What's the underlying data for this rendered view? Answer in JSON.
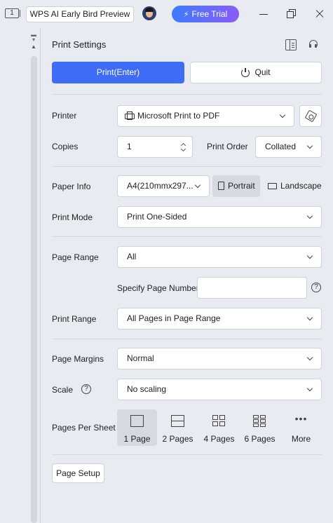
{
  "titlebar": {
    "page_count_badge": "1",
    "tab_title": "WPS AI Early Bird Preview",
    "free_trial_label": "Free Trial",
    "accent_gradient": [
      "#3d7bff",
      "#8a5cf6"
    ]
  },
  "panel": {
    "title": "Print Settings",
    "print_button": "Print(Enter)",
    "quit_button": "Quit",
    "primary_color": "#3f6cf5"
  },
  "printer": {
    "label": "Printer",
    "value": "Microsoft Print to PDF"
  },
  "copies": {
    "label": "Copies",
    "value": "1"
  },
  "print_order": {
    "label": "Print Order",
    "value": "Collated"
  },
  "paper_info": {
    "label": "Paper Info",
    "value": "A4(210mmx297...",
    "portrait": "Portrait",
    "landscape": "Landscape",
    "selected_orientation": "Portrait"
  },
  "print_mode": {
    "label": "Print Mode",
    "value": "Print One-Sided"
  },
  "page_range": {
    "label": "Page Range",
    "value": "All",
    "specify_label": "Specify Page Number",
    "specify_value": "",
    "help_glyph": "?"
  },
  "print_range": {
    "label": "Print Range",
    "value": "All Pages in Page Range"
  },
  "page_margins": {
    "label": "Page Margins",
    "value": "Normal"
  },
  "scale": {
    "label": "Scale",
    "value": "No scaling",
    "help_glyph": "?"
  },
  "pages_per_sheet": {
    "label": "Pages Per Sheet",
    "options": [
      {
        "label": "1 Page",
        "icon": "single-page-icon"
      },
      {
        "label": "2 Pages",
        "icon": "two-pages-icon"
      },
      {
        "label": "4 Pages",
        "icon": "four-pages-icon"
      },
      {
        "label": "6 Pages",
        "icon": "six-pages-icon"
      },
      {
        "label": "More",
        "icon": "more-icon"
      }
    ],
    "selected": "1 Page"
  },
  "page_setup_button": "Page Setup"
}
